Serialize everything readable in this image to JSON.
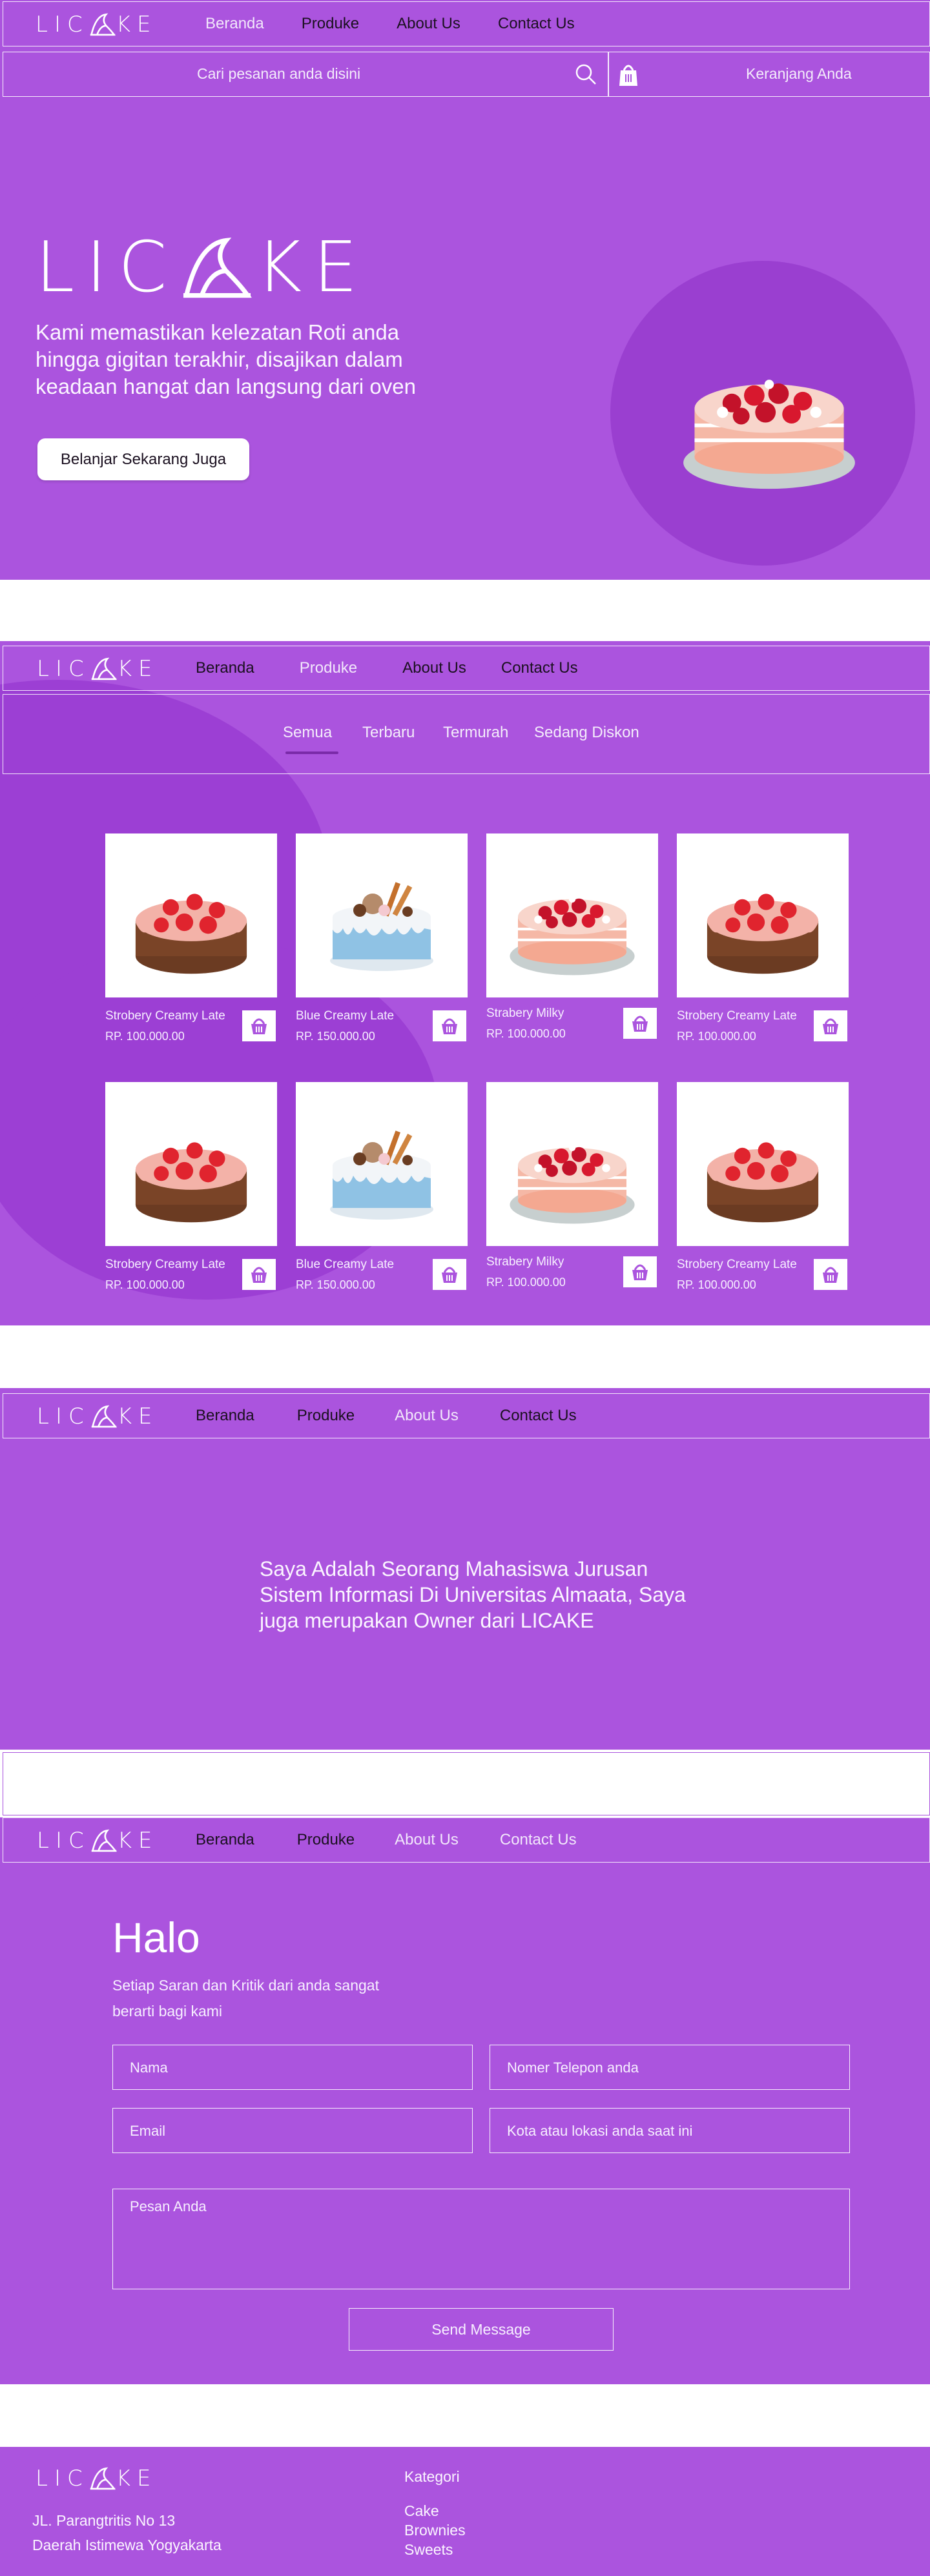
{
  "brand": {
    "logo_text": "LICAKE"
  },
  "nav": {
    "beranda": "Beranda",
    "produke": "Produke",
    "about": "About Us",
    "contact": "Contact Us"
  },
  "search": {
    "placeholder": "Cari pesanan anda disini",
    "cart_label": "Keranjang Anda"
  },
  "hero": {
    "tagline": "Kami memastikan kelezatan Roti anda hingga gigitan terakhir, disajikan dalam keadaan hangat dan langsung dari oven",
    "cta": "Belanjar Sekarang Juga"
  },
  "products": {
    "tabs": [
      "Semua",
      "Terbaru",
      "Termurah",
      "Sedang Diskon"
    ],
    "active_tab": "Semua",
    "items": [
      {
        "name": "Strobery Creamy Late",
        "price": "RP. 100.000.00",
        "icon": "strawberry-chocolate-cake"
      },
      {
        "name": "Blue Creamy Late",
        "price": "RP. 150.000.00",
        "icon": "blue-cream-cake"
      },
      {
        "name": "Strabery Milky",
        "price": "RP. 100.000.00",
        "icon": "strawberry-milky-cake"
      },
      {
        "name": "Strobery Creamy Late",
        "price": "RP. 100.000.00",
        "icon": "strawberry-chocolate-cake"
      },
      {
        "name": "Strobery Creamy Late",
        "price": "RP. 100.000.00",
        "icon": "strawberry-chocolate-cake"
      },
      {
        "name": "Blue Creamy Late",
        "price": "RP. 150.000.00",
        "icon": "blue-cream-cake"
      },
      {
        "name": "Strabery Milky",
        "price": "RP. 100.000.00",
        "icon": "strawberry-milky-cake"
      },
      {
        "name": "Strobery Creamy Late",
        "price": "RP. 100.000.00",
        "icon": "strawberry-chocolate-cake"
      }
    ]
  },
  "about": {
    "text": "Saya Adalah Seorang Mahasiswa Jurusan Sistem Informasi  Di Universitas Almaata, Saya juga merupakan Owner dari LICAKE"
  },
  "contact": {
    "title": "Halo",
    "subtitle": "Setiap Saran dan Kritik dari anda sangat berarti bagi kami",
    "name_placeholder": "Nama",
    "phone_placeholder": "Nomer Telepon anda",
    "email_placeholder": "Email",
    "city_placeholder": "Kota atau lokasi anda saat ini",
    "message_placeholder": "Pesan Anda",
    "send": "Send Message"
  },
  "footer": {
    "address_line1": "JL. Parangtritis No 13",
    "address_line2": "Daerah Istimewa Yogyakarta",
    "kategori_title": "Kategori",
    "kategori": [
      "Cake",
      "Brownies",
      "Sweets"
    ]
  },
  "colors": {
    "primary": "#ab54de",
    "primary_dark": "#9a3fd0",
    "accent_line": "#7a2aa8",
    "text_dark": "#1b1020"
  }
}
